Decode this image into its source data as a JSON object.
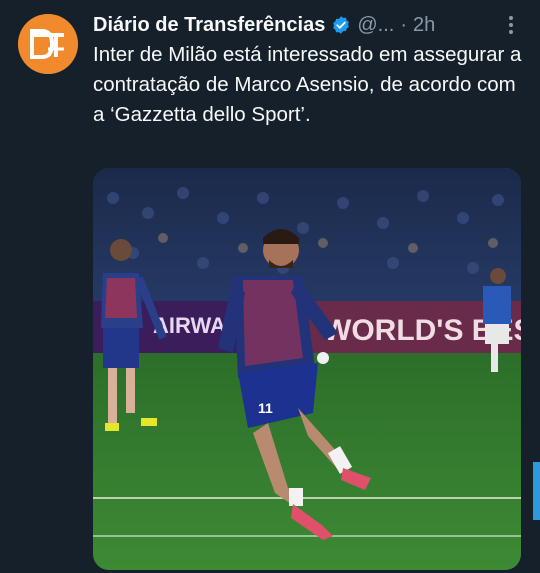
{
  "tweet": {
    "author_name": "Diário de Transferências",
    "handle": "@...",
    "separator": "·",
    "time": "2h",
    "avatar_initials": "DT",
    "text": "Inter de Milão está interessado em assegurar a contratação de Marco Asensio, de acordo com a ‘Gazzetta dello Sport’.",
    "media": {
      "board_text_1": "AIRWAY",
      "board_text_2": "WORLD'S BEST",
      "shirt_number": "11"
    }
  },
  "colors": {
    "background": "#15202b",
    "accent_avatar": "#f08a2c",
    "verified": "#1d9bf0",
    "muted": "#8b98a5",
    "pitch": "#2f7d2c"
  },
  "icons": [
    "verified-badge-icon",
    "more-options-icon"
  ]
}
